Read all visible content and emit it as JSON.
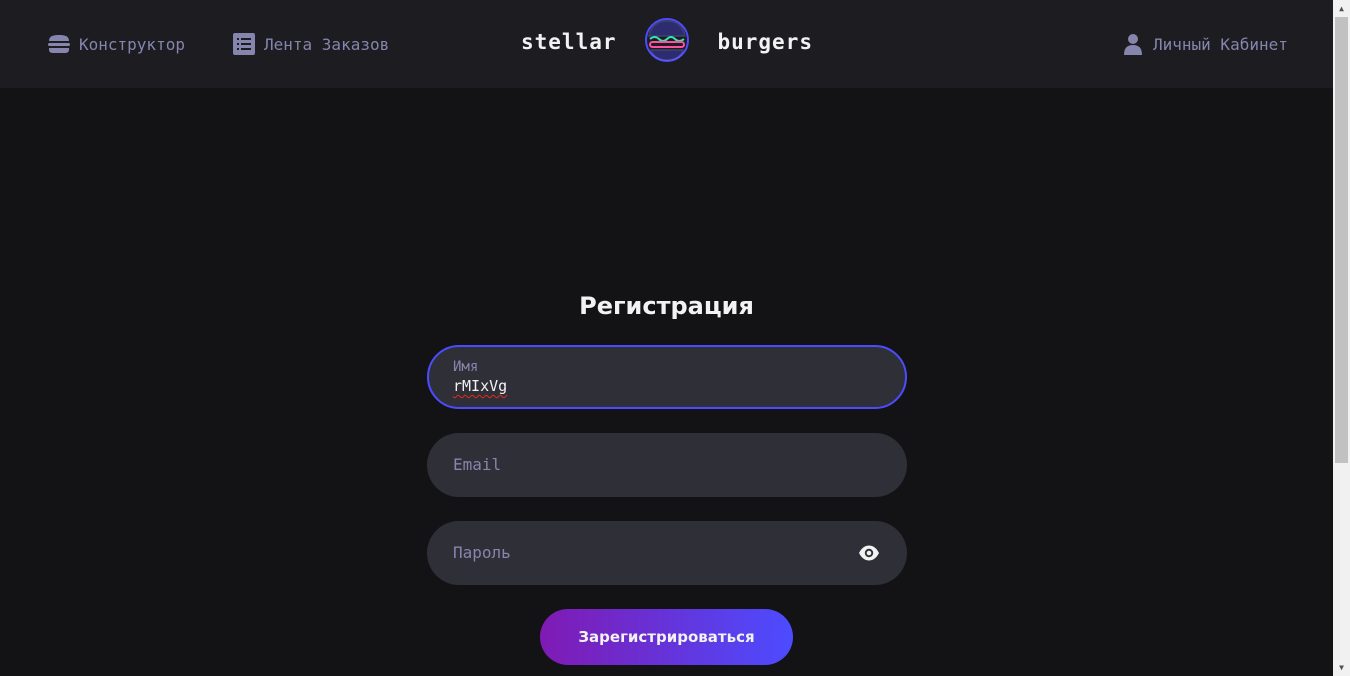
{
  "header": {
    "nav_constructor": "Конструктор",
    "nav_feed": "Лента Заказов",
    "logo_left": "stellar",
    "logo_right": "burgers",
    "nav_account": "Личный Кабинет"
  },
  "form": {
    "title": "Регистрация",
    "name_label": "Имя",
    "name_value": "rMIxVg",
    "email_placeholder": "Email",
    "password_placeholder": "Пароль",
    "submit_label": "Зарегистрироваться"
  },
  "icons": {
    "constructor": "burger-icon",
    "feed": "list-icon",
    "account": "profile-icon",
    "password": "eye-icon"
  },
  "colors": {
    "background": "#131316",
    "header": "#1C1C21",
    "input": "#2F2F37",
    "accent": "#4C4CFF",
    "gradient_start": "#801AB3",
    "text_inactive": "#8585AD",
    "text_primary": "#F2F2F3"
  }
}
